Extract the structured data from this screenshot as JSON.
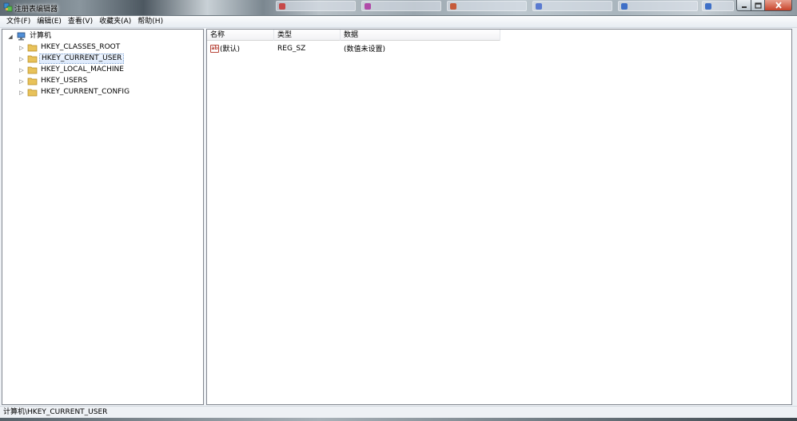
{
  "window": {
    "title": "注册表编辑器",
    "icon": "registry-editor-icon",
    "buttons": {
      "minimize": "minimize-icon",
      "maximize": "maximize-icon",
      "close": "close-icon"
    }
  },
  "menu": {
    "items": [
      "文件(F)",
      "编辑(E)",
      "查看(V)",
      "收藏夹(A)",
      "帮助(H)"
    ]
  },
  "tree": {
    "root": {
      "label": "计算机",
      "icon": "computer-icon",
      "expanded": true
    },
    "children": [
      {
        "label": "HKEY_CLASSES_ROOT",
        "icon": "folder-icon",
        "selected": false
      },
      {
        "label": "HKEY_CURRENT_USER",
        "icon": "folder-icon",
        "selected": true
      },
      {
        "label": "HKEY_LOCAL_MACHINE",
        "icon": "folder-icon",
        "selected": false
      },
      {
        "label": "HKEY_USERS",
        "icon": "folder-icon",
        "selected": false
      },
      {
        "label": "HKEY_CURRENT_CONFIG",
        "icon": "folder-icon",
        "selected": false
      }
    ]
  },
  "list": {
    "columns": [
      "名称",
      "类型",
      "数据"
    ],
    "rows": [
      {
        "name": "(默认)",
        "type": "REG_SZ",
        "data": "(数值未设置)",
        "icon": "string-value-icon"
      }
    ]
  },
  "status": {
    "path": "计算机\\HKEY_CURRENT_USER"
  },
  "colors": {
    "selection_border": "#7da2ce",
    "folder": "#e8c25a",
    "close_button": "#c7432a"
  }
}
